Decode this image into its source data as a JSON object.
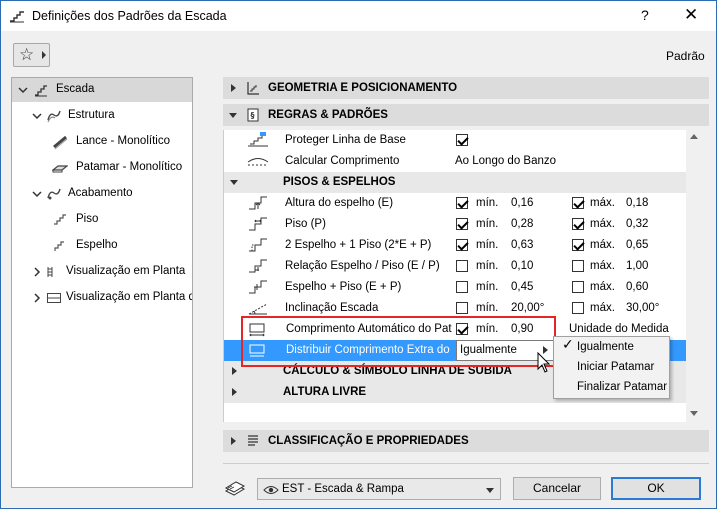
{
  "window": {
    "title": "Definições dos Padrões da Escada",
    "help_label": "?",
    "close_label": "✕"
  },
  "toolbar": {
    "favorites_icon": "star-icon",
    "default_label": "Padrão"
  },
  "tree": [
    {
      "label": "Escada",
      "icon": "stair-icon",
      "selected": true
    },
    {
      "label": "Estrutura",
      "icon": "structure-icon"
    },
    {
      "label": "Lance - Monolítico",
      "icon": "flight-icon"
    },
    {
      "label": "Patamar - Monolítico",
      "icon": "landing-icon"
    },
    {
      "label": "Acabamento",
      "icon": "finish-icon"
    },
    {
      "label": "Piso",
      "icon": "tread-icon"
    },
    {
      "label": "Espelho",
      "icon": "riser-icon"
    },
    {
      "label": "Visualização em Planta",
      "icon": "floorplan-icon"
    },
    {
      "label": "Visualização em Planta d",
      "icon": "floorplan-grid-icon"
    }
  ],
  "sections": {
    "geometry": "GEOMETRIA E POSICIONAMENTO",
    "rules": "REGRAS & PADRÕES",
    "classification": "CLASSIFICAÇÃO E PROPRIEDADES"
  },
  "rules": {
    "protect_baseline": {
      "label": "Proteger Linha de Base",
      "checked": true
    },
    "calc_length": {
      "label": "Calcular Comprimento",
      "value": "Ao Longo do Banzo"
    },
    "subsection_treads": "PISOS & ESPELHOS",
    "min_label": "mín.",
    "max_label": "máx.",
    "params": [
      {
        "label": "Altura do espelho (E)",
        "min_on": true,
        "min": "0,16",
        "max_on": true,
        "max": "0,18"
      },
      {
        "label": "Piso (P)",
        "min_on": true,
        "min": "0,28",
        "max_on": true,
        "max": "0,32"
      },
      {
        "label": "2 Espelho + 1 Piso (2*E + P)",
        "min_on": true,
        "min": "0,63",
        "max_on": true,
        "max": "0,65"
      },
      {
        "label": "Relação Espelho / Piso (E / P)",
        "min_on": false,
        "min": "0,10",
        "max_on": false,
        "max": "1,00"
      },
      {
        "label": "Espelho + Piso (E + P)",
        "min_on": false,
        "min": "0,45",
        "max_on": false,
        "max": "0,60"
      },
      {
        "label": "Inclinação Escada",
        "min_on": false,
        "min": "20,00°",
        "max_on": false,
        "max": "30,00°"
      }
    ],
    "auto_length": {
      "label": "Comprimento Automático do Pat",
      "min_on": true,
      "min": "0,90",
      "unit_label": "Unidade do Medida"
    },
    "distribute": {
      "label": "Distribuir Comprimento Extra do",
      "value": "Igualmente"
    },
    "subsection_calc": "CÁLCULO & SÍMBOLO LINHA DE SUBIDA",
    "subsection_headroom": "ALTURA LIVRE"
  },
  "popup": {
    "options": [
      "Igualmente",
      "Iniciar Patamar",
      "Finalizar Patamar"
    ],
    "selected": "Igualmente"
  },
  "footer": {
    "favorite_value": "EST - Escada & Rampa",
    "cancel_label": "Cancelar",
    "ok_label": "OK"
  },
  "colors": {
    "highlight": "#3399ff",
    "callout": "#e32626",
    "ok_border": "#2b7bd6"
  }
}
